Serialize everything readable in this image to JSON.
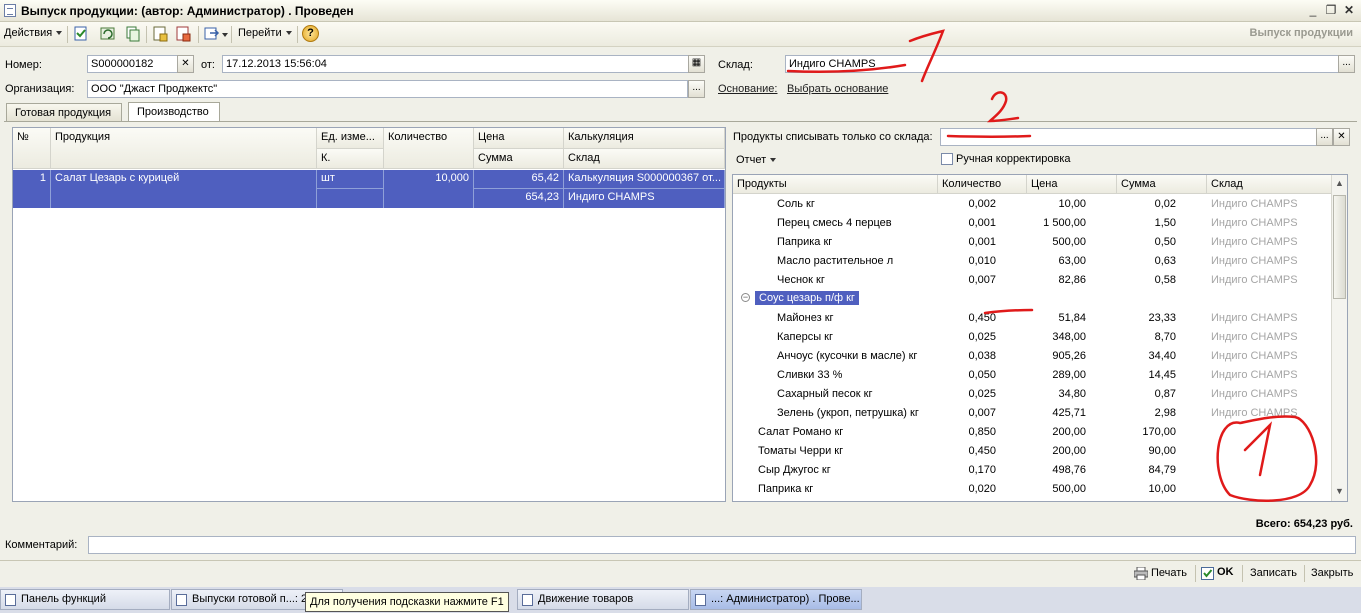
{
  "window": {
    "title": "Выпуск продукции: (автор: Администратор) . Проведен",
    "doc_kind": "Выпуск продукции"
  },
  "toolbar": {
    "actions_label": "Действия",
    "goto_label": "Перейти",
    "help_icon": "?"
  },
  "form": {
    "number_label": "Номер:",
    "number_value": "S000000182",
    "date_label": "от:",
    "date_value": "17.12.2013 15:56:04",
    "org_label": "Организация:",
    "org_value": "ООО \"Джаст Проджектс\"",
    "warehouse_label": "Склад:",
    "warehouse_value": "Индиго CHAMPS",
    "basis_label": "Основание:",
    "basis_value": "Выбрать основание"
  },
  "tabs": [
    {
      "label": "Готовая продукция"
    },
    {
      "label": "Производство"
    }
  ],
  "left_table": {
    "headers": {
      "num": "№",
      "product": "Продукция",
      "unit": "Ед. изме...",
      "unit2": "К.",
      "qty": "Количество",
      "price": "Цена",
      "sum": "Сумма",
      "calc": "Калькуляция",
      "wh": "Склад"
    },
    "rows": [
      {
        "num": "1",
        "product": "Салат Цезарь с курицей",
        "unit": "шт",
        "qty": "10,000",
        "price": "65,42",
        "sum": "654,23",
        "calc": "Калькуляция S000000367 от...",
        "wh": "Индиго CHAMPS"
      }
    ]
  },
  "right_panel": {
    "writeoff_label": "Продукты списывать только со склада:",
    "writeoff_value": "",
    "report_label": "Отчет",
    "manual_label": "Ручная корректировка",
    "headers": {
      "product": "Продукты",
      "qty": "Количество",
      "price": "Цена",
      "sum": "Сумма",
      "wh": "Склад"
    },
    "rows": [
      {
        "name": "Соль   кг",
        "qty": "0,002",
        "price": "10,00",
        "sum": "0,02",
        "wh": "Индиго CHAMPS",
        "level": 2
      },
      {
        "name": "Перец смесь 4 перцев",
        "qty": "0,001",
        "price": "1 500,00",
        "sum": "1,50",
        "wh": "Индиго CHAMPS",
        "level": 2
      },
      {
        "name": "Паприка   кг",
        "qty": "0,001",
        "price": "500,00",
        "sum": "0,50",
        "wh": "Индиго CHAMPS",
        "level": 2
      },
      {
        "name": "Масло растительное      л",
        "qty": "0,010",
        "price": "63,00",
        "sum": "0,63",
        "wh": "Индиго CHAMPS",
        "level": 2
      },
      {
        "name": "Чеснок   кг",
        "qty": "0,007",
        "price": "82,86",
        "sum": "0,58",
        "wh": "Индиго CHAMPS",
        "level": 2
      },
      {
        "name": "Соус цезарь п/ф  кг",
        "qty": "",
        "price": "",
        "sum": "",
        "wh": "",
        "level": 1,
        "group": true
      },
      {
        "name": "Майонез   кг",
        "qty": "0,450",
        "price": "51,84",
        "sum": "23,33",
        "wh": "Индиго CHAMPS",
        "level": 2
      },
      {
        "name": "Каперсы   кг",
        "qty": "0,025",
        "price": "348,00",
        "sum": "8,70",
        "wh": "Индиго CHAMPS",
        "level": 2
      },
      {
        "name": "Анчоус (кусочки в масле)   кг",
        "qty": "0,038",
        "price": "905,26",
        "sum": "34,40",
        "wh": "Индиго CHAMPS",
        "level": 2
      },
      {
        "name": "Сливки  33 %",
        "qty": "0,050",
        "price": "289,00",
        "sum": "14,45",
        "wh": "Индиго CHAMPS",
        "level": 2
      },
      {
        "name": "Сахарный песок   кг",
        "qty": "0,025",
        "price": "34,80",
        "sum": "0,87",
        "wh": "Индиго CHAMPS",
        "level": 2
      },
      {
        "name": "Зелень (укроп, петрушка)   кг",
        "qty": "0,007",
        "price": "425,71",
        "sum": "2,98",
        "wh": "Индиго CHAMPS",
        "level": 2
      },
      {
        "name": "Салат Романо   кг",
        "qty": "0,850",
        "price": "200,00",
        "sum": "170,00",
        "wh": "",
        "level": 1
      },
      {
        "name": "Томаты Черри   кг",
        "qty": "0,450",
        "price": "200,00",
        "sum": "90,00",
        "wh": "",
        "level": 1
      },
      {
        "name": "Сыр Джугос   кг",
        "qty": "0,170",
        "price": "498,76",
        "sum": "84,79",
        "wh": "",
        "level": 1
      },
      {
        "name": "Паприка   кг",
        "qty": "0,020",
        "price": "500,00",
        "sum": "10,00",
        "wh": "",
        "level": 1
      }
    ]
  },
  "total": {
    "label": "Всего: 654,23 руб."
  },
  "comment": {
    "label": "Комментарий:",
    "value": ""
  },
  "bottom_buttons": {
    "print": "Печать",
    "ok": "OK",
    "save": "Записать",
    "close": "Закрыть"
  },
  "taskbar": [
    {
      "label": "Панель функций"
    },
    {
      "label": "Выпуски готовой п...: 2"
    },
    {
      "label": "Движение товаров"
    },
    {
      "label": "...: Администратор) . Прове..."
    }
  ],
  "tooltip": "Для получения подсказки нажмите F1",
  "annotations": {
    "mark_1": "1",
    "mark_2": "2"
  },
  "colors": {
    "selection": "#4f5fbf",
    "annotation": "#e01a1a"
  }
}
